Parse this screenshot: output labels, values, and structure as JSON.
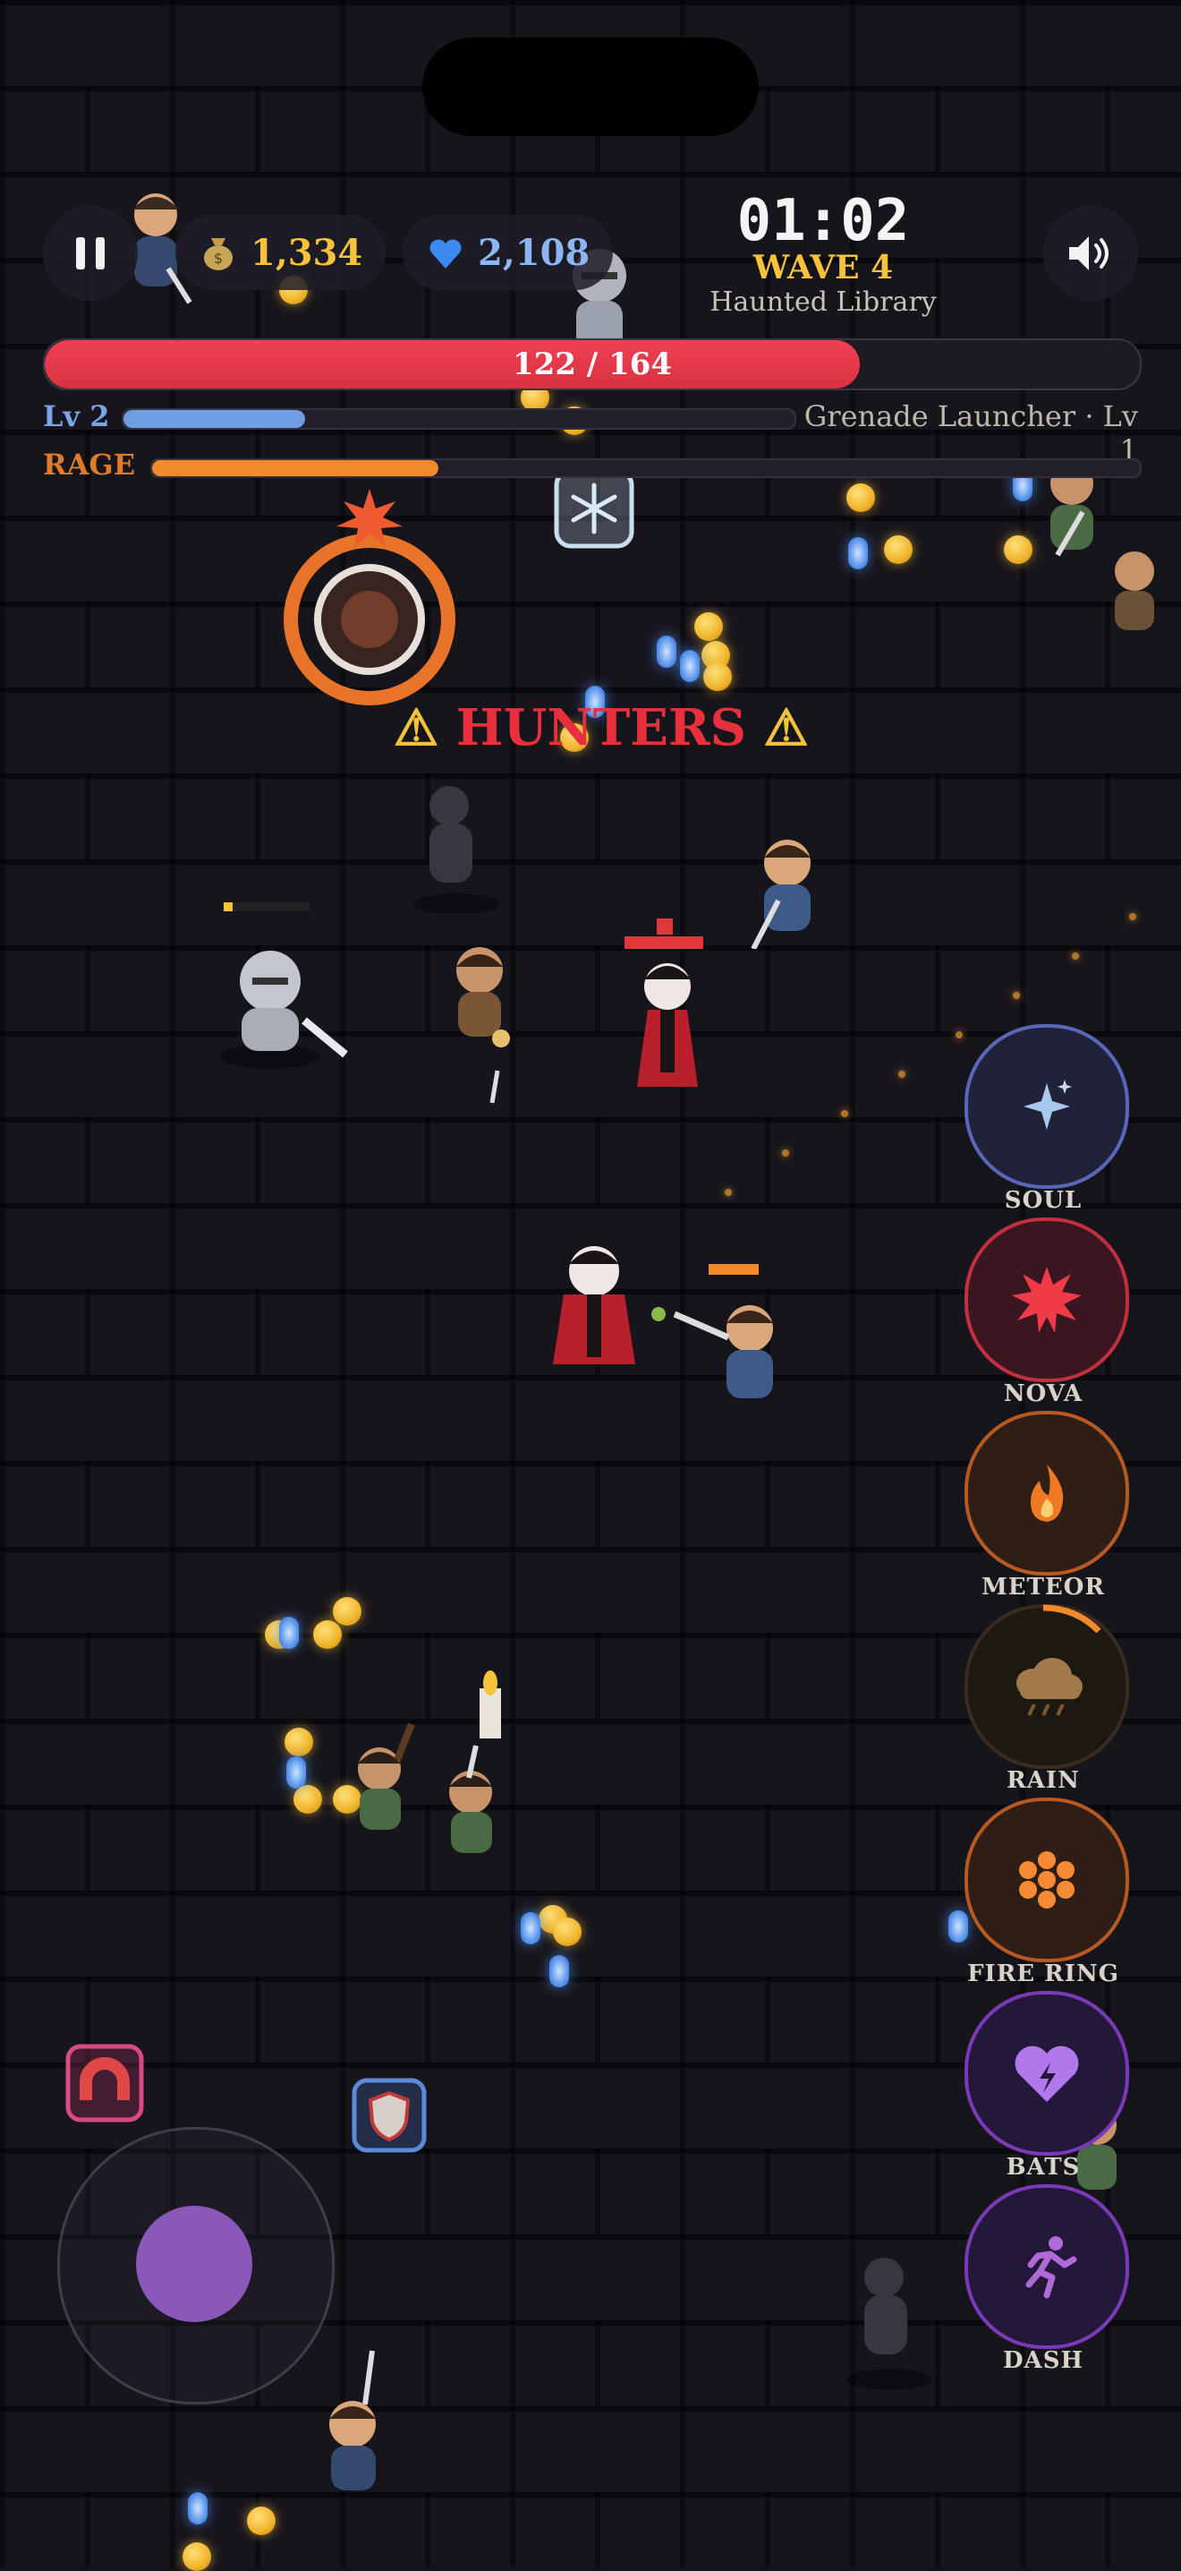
{
  "hud": {
    "gold": "1,334",
    "gems": "2,108",
    "timer": "01:02",
    "wave": "WAVE 4",
    "stage": "Haunted Library",
    "hp_text": "122 / 164",
    "hp_fraction": 0.744,
    "level": "Lv 2",
    "xp_fraction": 0.27,
    "weapon": "Grenade Launcher · Lv 1",
    "rage_label": "RAGE",
    "rage_fraction": 0.29
  },
  "warning": {
    "text": "HUNTERS"
  },
  "abilities": [
    {
      "label": "SOUL",
      "icon": "sparkle-icon",
      "color": "#5a66b8"
    },
    {
      "label": "NOVA",
      "icon": "nova-burst-icon",
      "color": "#c23040"
    },
    {
      "label": "METEOR",
      "icon": "flame-icon",
      "color": "#b85a20"
    },
    {
      "label": "RAIN",
      "icon": "storm-cloud-icon",
      "color": "#6a4a28"
    },
    {
      "label": "FIRE RING",
      "icon": "fire-ring-icon",
      "color": "#b85a20"
    },
    {
      "label": "BATS",
      "icon": "purple-heart-icon",
      "color": "#7a3ab8"
    },
    {
      "label": "DASH",
      "icon": "running-figure-icon",
      "color": "#7a3ab8"
    }
  ],
  "colors": {
    "hp": "#e8394a",
    "xp": "#6f9ee3",
    "rage": "#f08a2c",
    "accent": "#f5c23c"
  }
}
